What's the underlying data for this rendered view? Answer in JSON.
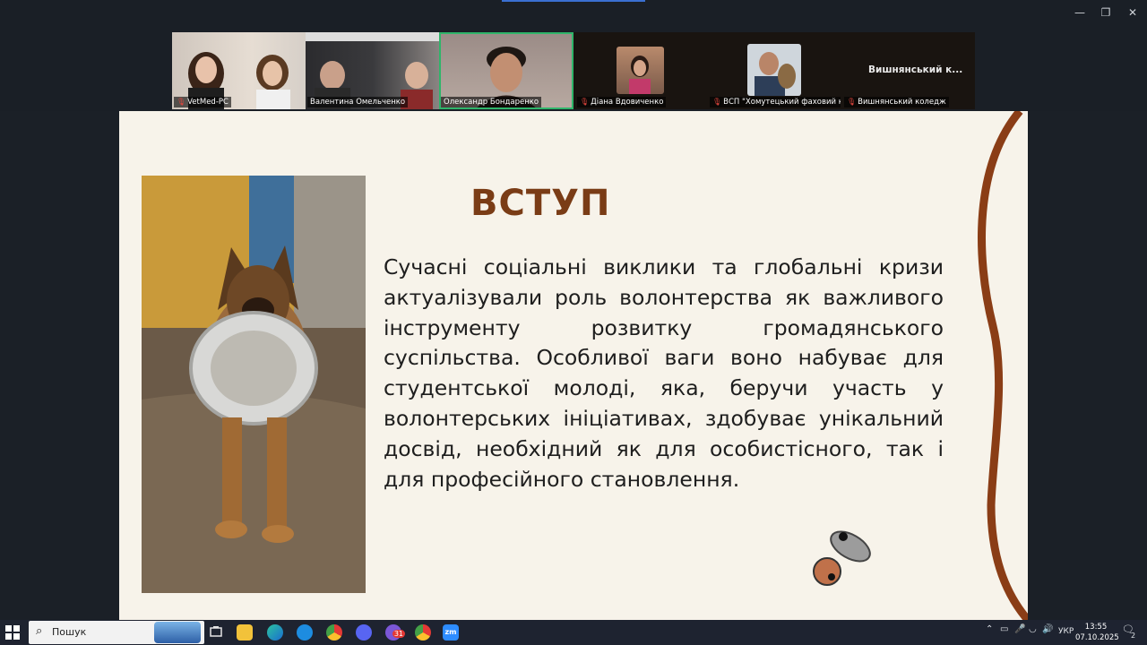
{
  "window": {
    "min_glyph": "—",
    "restore_glyph": "❐",
    "close_glyph": "✕"
  },
  "participants": [
    {
      "name": "VetMed-PC",
      "muted": true
    },
    {
      "name": "Валентина Омельченко",
      "muted": false
    },
    {
      "name": "Олександр Бондаренко",
      "muted": false,
      "active": true
    },
    {
      "name": "Діана Вдовиченко",
      "muted": true
    },
    {
      "name": "ВСП \"Хомутецький фаховий кол...",
      "muted": true
    },
    {
      "name": "Вишнянський коледж",
      "muted": true
    }
  ],
  "overflow_tile_label": "Вишнянський к...",
  "slide": {
    "title": "ВСТУП",
    "body": "Сучасні соціальні виклики та глобальні кризи актуалізували роль волонтерства як важливого інструменту розвитку громадянського суспільства. Особливої ваги воно набуває для студентської молоді, яка, беручи участь у волонтерських ініціативах, здобуває унікальний досвід, необхідний як для особистісного, так і для професійного становлення.",
    "accent_color": "#7a3c16"
  },
  "taskbar": {
    "search_label": "Пошук",
    "language": "УКР",
    "time": "13:55",
    "date": "07.10.2025",
    "notification_count": "2",
    "apps": [
      "file-explorer-icon",
      "edge-icon",
      "skype-icon",
      "chrome-icon",
      "discord-icon",
      "viber-icon",
      "chrome-profile-icon",
      "zoom-icon"
    ],
    "zoom_label": "zm",
    "calendar_badge": "31"
  }
}
